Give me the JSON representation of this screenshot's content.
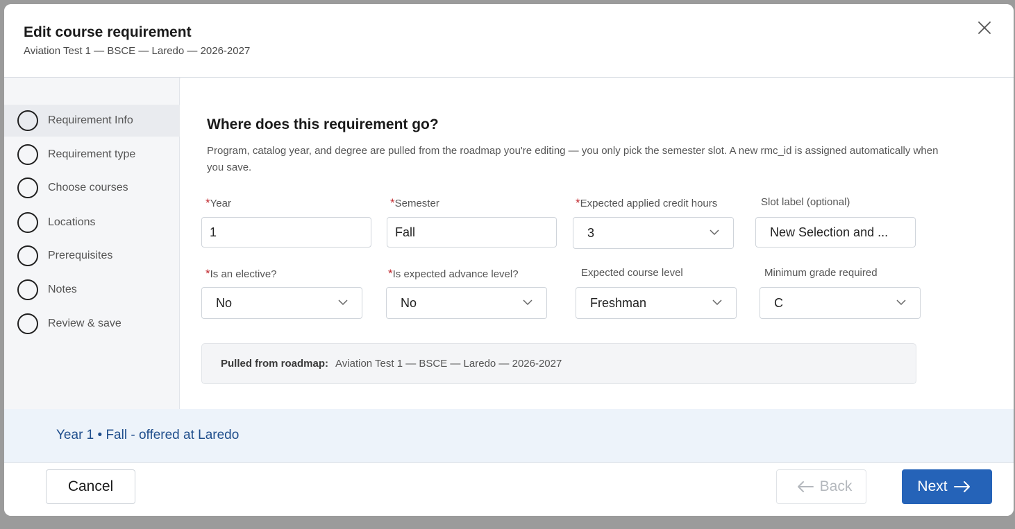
{
  "dialog": {
    "title": "Edit course requirement",
    "subtitle": "Aviation Test 1 — BSCE — Laredo — 2026-2027",
    "close_icon": "close-icon"
  },
  "steps": [
    {
      "label": "Requirement Info",
      "active": true
    },
    {
      "label": "Requirement type",
      "active": false
    },
    {
      "label": "Choose courses",
      "active": false
    },
    {
      "label": "Locations",
      "active": false
    },
    {
      "label": "Prerequisites",
      "active": false
    },
    {
      "label": "Notes",
      "active": false
    },
    {
      "label": "Review & save",
      "active": false
    }
  ],
  "section": {
    "title": "Where does this requirement go?",
    "description": "Program, catalog year, and degree are pulled from the roadmap you're editing — you only pick the semester slot. A new rmc_id is assigned automatically when you save."
  },
  "fields": {
    "year": {
      "label": "Year",
      "required": true,
      "value": "1"
    },
    "semester": {
      "label": "Semester",
      "required": true,
      "value": "Fall"
    },
    "credit_hours": {
      "label": "Expected applied credit hours",
      "required": true,
      "value": "3"
    },
    "slot_label": {
      "label": "Slot label (optional)",
      "required": false,
      "value": "New Selection and ..."
    },
    "elective": {
      "label": "Is an elective?",
      "required": true,
      "value": "No"
    },
    "advance_level": {
      "label": "Is expected advance level?",
      "required": true,
      "value": "No"
    },
    "course_level": {
      "label": "Expected course level",
      "required": false,
      "value": "Freshman"
    },
    "min_grade": {
      "label": "Minimum grade required",
      "required": false,
      "value": "C"
    }
  },
  "required_marker": "*",
  "pulled": {
    "key": "Pulled from roadmap:",
    "value": "Aviation Test 1 — BSCE — Laredo — 2026-2027"
  },
  "summary": {
    "text": "Year 1 • Fall - offered at Laredo"
  },
  "footer": {
    "cancel_label": "Cancel",
    "back_label": "Back",
    "next_label": "Next"
  },
  "colors": {
    "primary": "#2563b8",
    "required": "#c0282d",
    "summary_text": "#1f4e8c",
    "summary_bg": "#edf3fa"
  }
}
